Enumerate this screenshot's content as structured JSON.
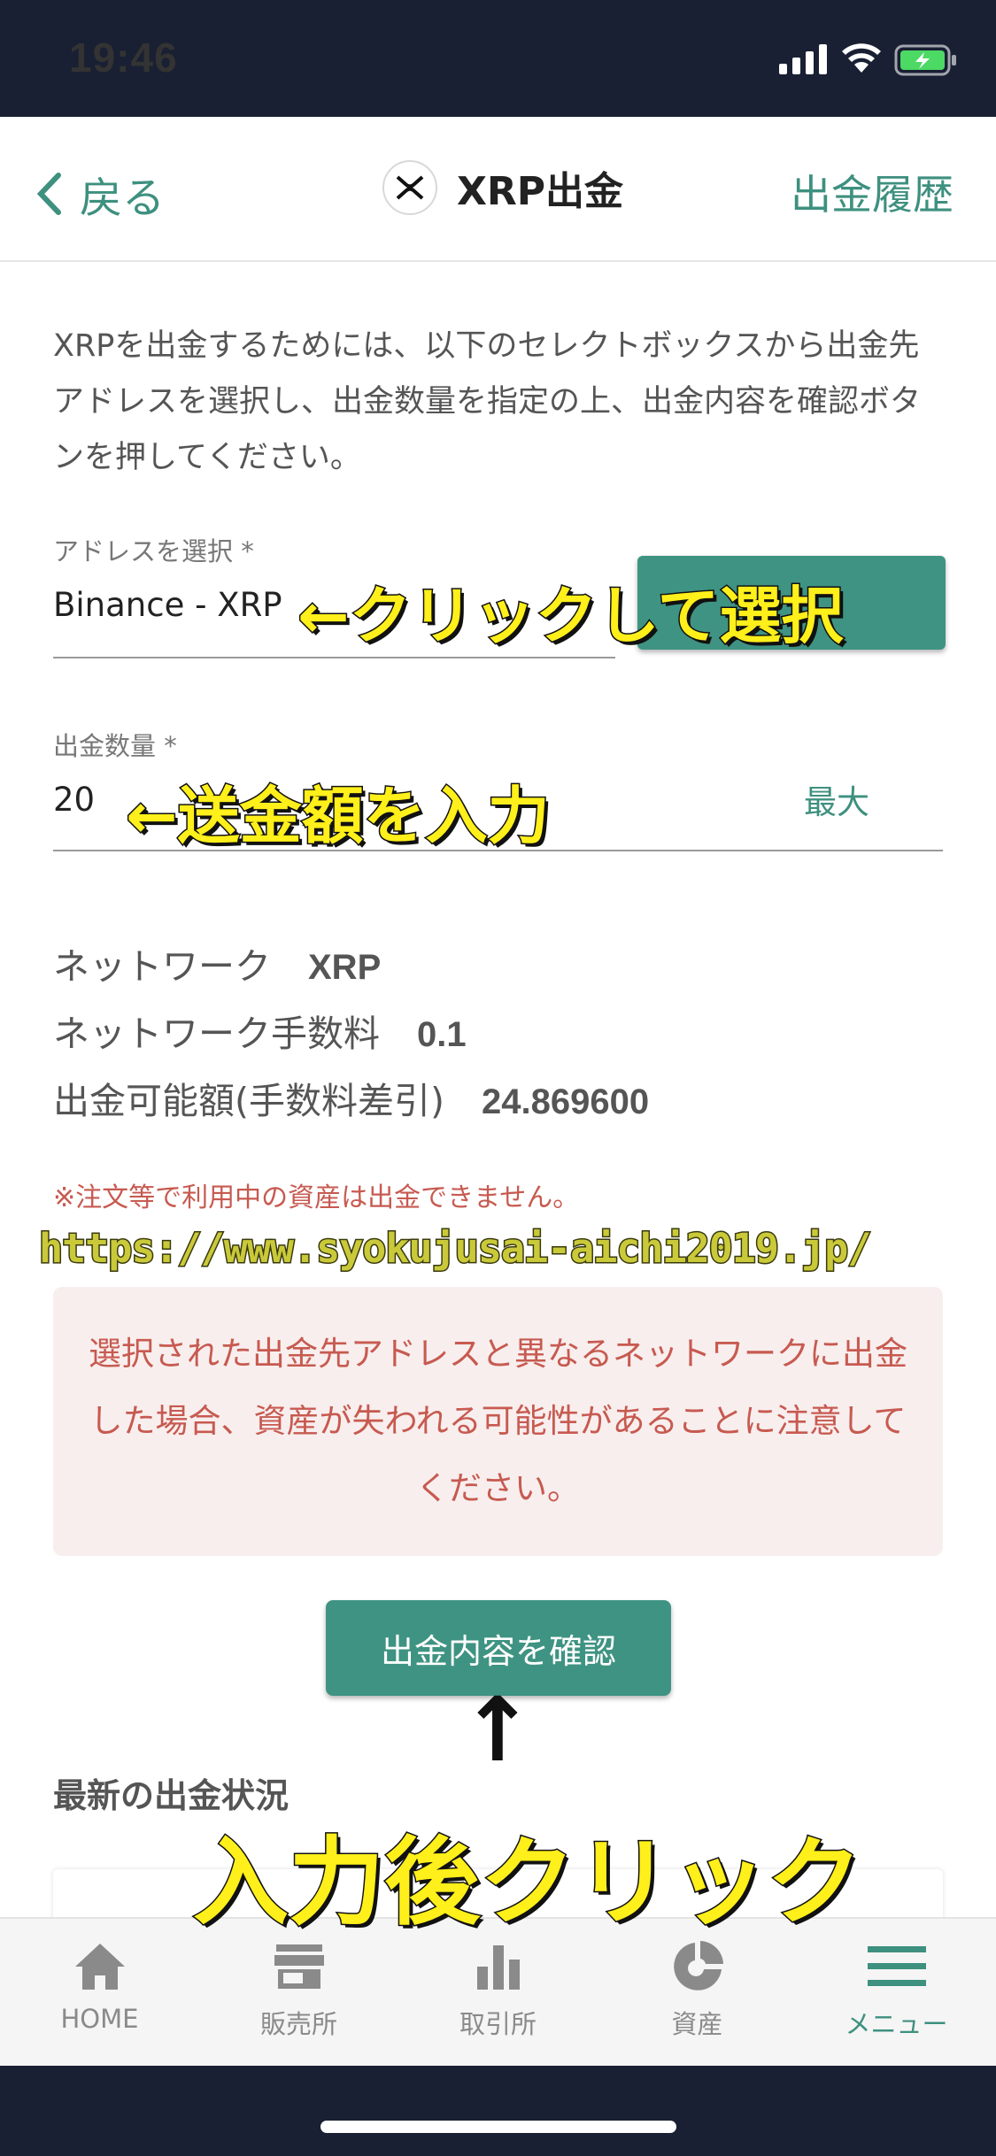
{
  "status_bar": {
    "time": "19:46"
  },
  "nav": {
    "back_label": "戻る",
    "title": "XRP出金",
    "history_label": "出金履歴"
  },
  "description": "XRPを出金するためには、以下のセレクトボックスから出金先アドレスを選択し、出金数量を指定の上、出金内容を確認ボタンを押してください。",
  "address_field": {
    "label": "アドレスを選択 *",
    "value": "Binance - XRP"
  },
  "amount_field": {
    "label": "出金数量 *",
    "value": "20",
    "max_label": "最大"
  },
  "info": {
    "network_label": "ネットワーク",
    "network_value": "XRP",
    "fee_label": "ネットワーク手数料",
    "fee_value": "0.1",
    "available_label": "出金可能額(手数料差引)",
    "available_value": "24.869600"
  },
  "note": "※注文等で利用中の資産は出金できません。",
  "warning": "選択された出金先アドレスと異なるネットワークに出金した場合、資産が失われる可能性があることに注意してください。",
  "confirm_button": "出金内容を確認",
  "latest_heading": "最新の出金状況",
  "tabs": [
    {
      "label": "HOME",
      "icon": "home-icon"
    },
    {
      "label": "販売所",
      "icon": "store-icon"
    },
    {
      "label": "取引所",
      "icon": "bar-chart-icon"
    },
    {
      "label": "資産",
      "icon": "pie-chart-icon"
    },
    {
      "label": "メニュー",
      "icon": "menu-icon"
    }
  ],
  "annotations": {
    "select_hint": "←クリックして選択",
    "amount_hint": "←送金額を入力",
    "url": "https://www.syokujusai-aichi2019.jp/",
    "arrow": "↑",
    "click_hint": "入力後クリック"
  },
  "colors": {
    "accent": "#3f9382",
    "warning": "#c75a50",
    "statusbar": "#192033",
    "annotation": "#ffef1a"
  }
}
